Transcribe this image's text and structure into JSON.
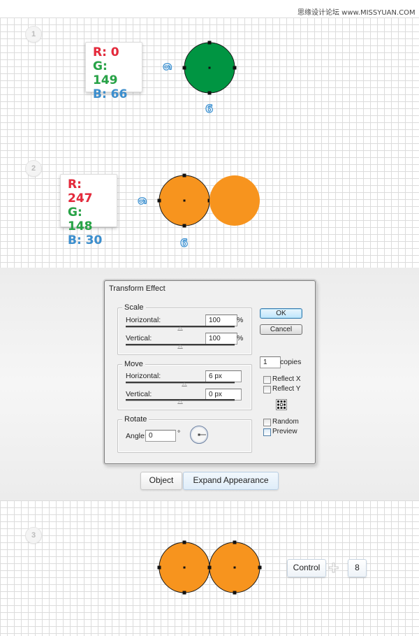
{
  "watermark": "思缘设计论坛 www.MISSYUAN.COM",
  "steps": {
    "step1": {
      "number": "1",
      "rgb": {
        "r": "R: 0",
        "g": "G: 149",
        "b": "B: 66"
      },
      "dim_horizontal": "6",
      "dim_vertical": "6"
    },
    "step2": {
      "number": "2",
      "rgb": {
        "r": "R: 247",
        "g": "G: 148",
        "b": "B: 30"
      },
      "dim_horizontal": "6",
      "dim_vertical": "6"
    },
    "step3": {
      "number": "3",
      "shortcut_key1": "Control",
      "shortcut_key2": "8"
    }
  },
  "colors": {
    "green": "#009542",
    "orange": "#f7941e",
    "red_label": "#e8293b",
    "green_label": "#27a547",
    "blue_label": "#3a8fd0"
  },
  "dialog": {
    "title": "Transform Effect",
    "scale": {
      "label": "Scale",
      "horizontal_label": "Horizontal:",
      "horizontal_value": "100",
      "horizontal_unit": "%",
      "vertical_label": "Vertical:",
      "vertical_value": "100",
      "vertical_unit": "%"
    },
    "move": {
      "label": "Move",
      "horizontal_label": "Horizontal:",
      "horizontal_value": "6 px",
      "vertical_label": "Vertical:",
      "vertical_value": "0 px"
    },
    "rotate": {
      "label": "Rotate",
      "angle_label": "Angle:",
      "angle_value": "0",
      "angle_unit": "°"
    },
    "ok_label": "OK",
    "cancel_label": "Cancel",
    "copies_value": "1",
    "copies_label": "copies",
    "reflect_x_label": "Reflect X",
    "reflect_y_label": "Reflect Y",
    "random_label": "Random",
    "preview_label": "Preview"
  },
  "menu_path": {
    "item1": "Object",
    "item2": "Expand Appearance"
  }
}
